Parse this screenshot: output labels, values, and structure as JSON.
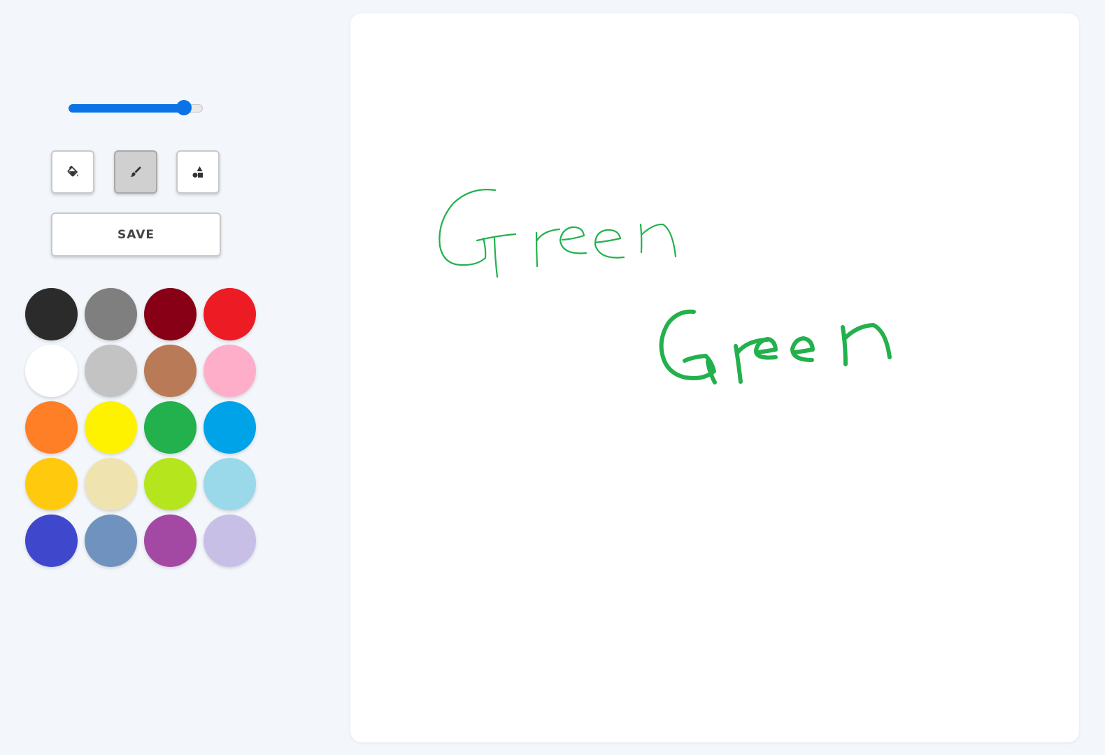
{
  "brush": {
    "size_fraction": 0.87
  },
  "tools": [
    {
      "name": "fill-tool",
      "icon": "paint-bucket-icon",
      "active": false
    },
    {
      "name": "brush-tool",
      "icon": "paintbrush-icon",
      "active": true
    },
    {
      "name": "shapes-tool",
      "icon": "shapes-icon",
      "active": false
    }
  ],
  "save_label": "SAVE",
  "colors": {
    "accent": "#0a73e6",
    "stroke": "#22b14c"
  },
  "palette": [
    "#2b2b2b",
    "#7f7f7f",
    "#880015",
    "#ed1c24",
    "#ffffff",
    "#c3c3c3",
    "#b97a57",
    "#ffaec9",
    "#ff7f27",
    "#fff200",
    "#22b14c",
    "#00a2e8",
    "#ffc90e",
    "#efe4b0",
    "#b5e61d",
    "#99d9ea",
    "#3f48cc",
    "#7092be",
    "#a349a4",
    "#c8bfe7"
  ]
}
